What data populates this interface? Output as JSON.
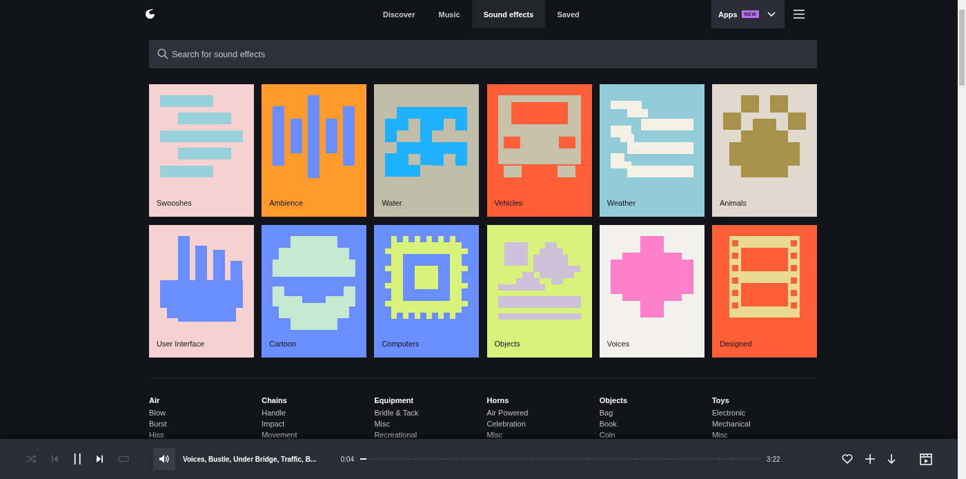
{
  "nav": {
    "tabs": [
      {
        "label": "Discover",
        "selected": false
      },
      {
        "label": "Music",
        "selected": false
      },
      {
        "label": "Sound effects",
        "selected": true
      },
      {
        "label": "Saved",
        "selected": false
      }
    ],
    "apps": {
      "label": "Apps",
      "badge": "NEW"
    }
  },
  "search": {
    "placeholder": "Search for sound effects"
  },
  "categories": [
    {
      "label": "Swooshes",
      "kind": "swooshes",
      "color": "#f6d1d1"
    },
    {
      "label": "Ambience",
      "kind": "ambience",
      "color": "#ff9b2b"
    },
    {
      "label": "Water",
      "kind": "water",
      "color": "#c1bda8"
    },
    {
      "label": "Vehicles",
      "kind": "vehicles",
      "color": "#ff5e37"
    },
    {
      "label": "Weather",
      "kind": "weather",
      "color": "#93ccd9"
    },
    {
      "label": "Animals",
      "kind": "animals",
      "color": "#e1d9cd"
    },
    {
      "label": "User Interface",
      "kind": "hand",
      "color": "#f6d1d1"
    },
    {
      "label": "Cartoon",
      "kind": "cartoon",
      "color": "#6a8dff"
    },
    {
      "label": "Computers",
      "kind": "chip",
      "color": "#6a8dff"
    },
    {
      "label": "Objects",
      "kind": "objects",
      "color": "#d9f27c"
    },
    {
      "label": "Voices",
      "kind": "voices",
      "color": "#f3f1ec"
    },
    {
      "label": "Designed",
      "kind": "film",
      "color": "#ff5e37"
    }
  ],
  "link_columns": [
    {
      "heading": "Air",
      "links": [
        "Blow",
        "Burst",
        "Hiss"
      ]
    },
    {
      "heading": "Chains",
      "links": [
        "Handle",
        "Impact",
        "Movement"
      ]
    },
    {
      "heading": "Equipment",
      "links": [
        "Bridle & Tack",
        "Misc",
        "Recreational"
      ]
    },
    {
      "heading": "Horns",
      "links": [
        "Air Powered",
        "Celebration",
        "Misc"
      ]
    },
    {
      "heading": "Objects",
      "links": [
        "Bag",
        "Book",
        "Coin"
      ]
    },
    {
      "heading": "Toys",
      "links": [
        "Electronic",
        "Mechanical",
        "Misc"
      ]
    }
  ],
  "player": {
    "track_title": "Voices, Bustle, Under Bridge, Traffic, B...",
    "elapsed": "0:04",
    "duration": "3:22",
    "level": 0.015,
    "playing": true
  }
}
